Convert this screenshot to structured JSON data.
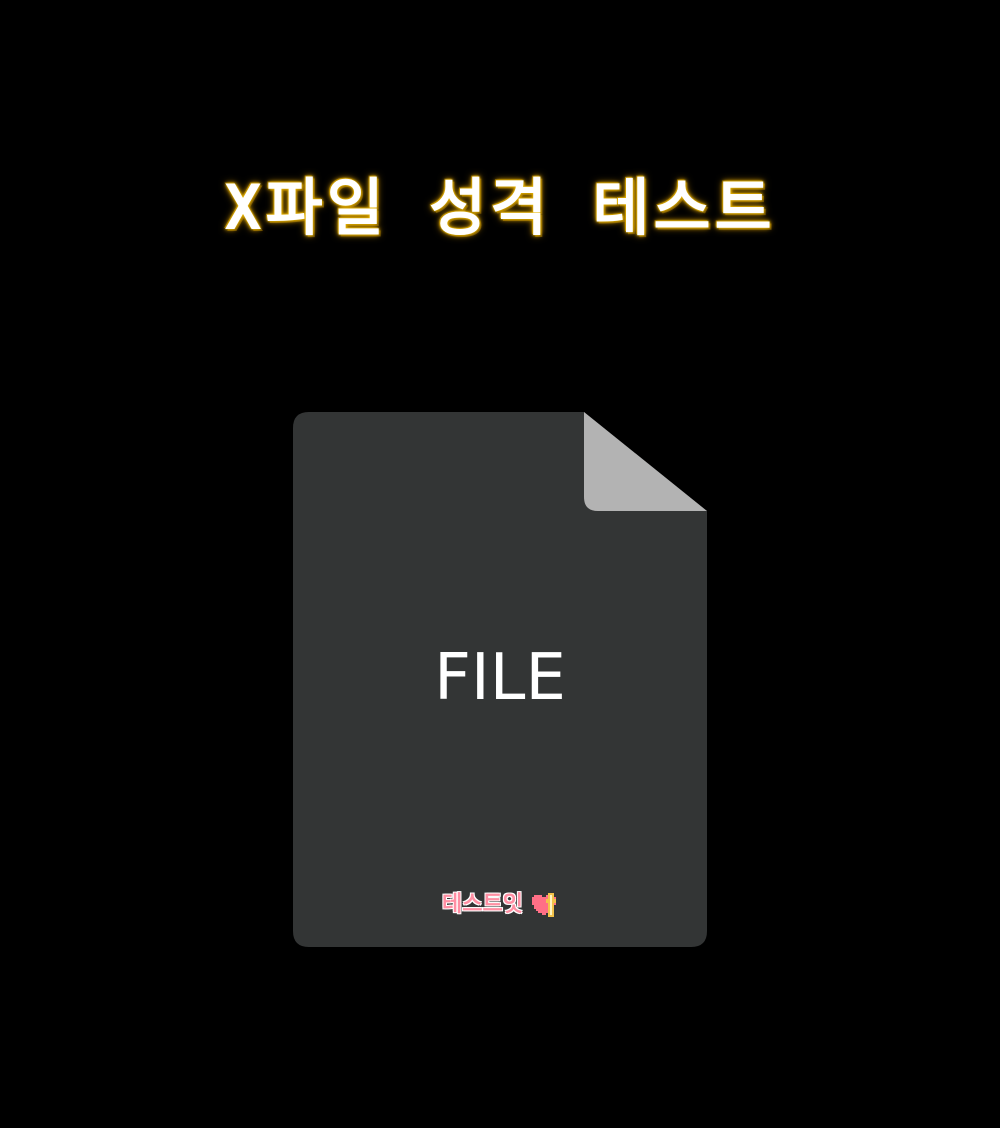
{
  "title": "X파일 성격 테스트",
  "file": {
    "label": "FILE",
    "body_color": "#333535",
    "fold_color": "#b3b3b3"
  },
  "brand": {
    "text": "테스트잇",
    "text_color": "#ff8fa3",
    "heart_icon": "pixel-heart-icon"
  },
  "colors": {
    "background": "#000000",
    "title_glow": "#e0a800"
  }
}
